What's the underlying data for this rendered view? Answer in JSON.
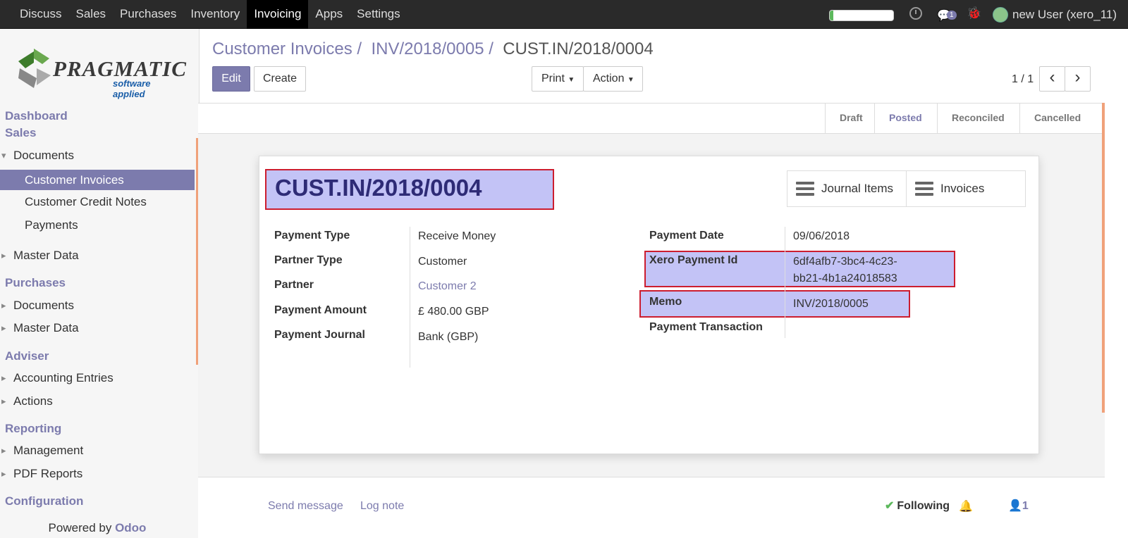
{
  "topbar": {
    "menu": [
      "Discuss",
      "Sales",
      "Purchases",
      "Inventory",
      "Invoicing",
      "Apps",
      "Settings"
    ],
    "active_menu": "Invoicing",
    "chat_count": "1",
    "user": "new User (xero_11)",
    "progress": 0.05
  },
  "sidebar": {
    "logo_word": "PRAGMATIC",
    "logo_tag": "software applied",
    "items": [
      {
        "label": "Dashboard",
        "kind": "head"
      },
      {
        "label": "Sales",
        "kind": "head"
      },
      {
        "label": "Documents",
        "kind": "open"
      },
      {
        "label": "Customer Invoices",
        "kind": "sub-active"
      },
      {
        "label": "Customer Credit Notes",
        "kind": "sub"
      },
      {
        "label": "Payments",
        "kind": "sub"
      },
      {
        "label": "Master Data",
        "kind": "tri"
      },
      {
        "label": "Purchases",
        "kind": "head"
      },
      {
        "label": "Documents",
        "kind": "tri"
      },
      {
        "label": "Master Data",
        "kind": "tri"
      },
      {
        "label": "Adviser",
        "kind": "head"
      },
      {
        "label": "Accounting Entries",
        "kind": "tri"
      },
      {
        "label": "Actions",
        "kind": "tri"
      },
      {
        "label": "Reporting",
        "kind": "head"
      },
      {
        "label": "Management",
        "kind": "tri"
      },
      {
        "label": "PDF Reports",
        "kind": "tri"
      },
      {
        "label": "Configuration",
        "kind": "head"
      }
    ],
    "powered_by": "Powered by",
    "powered_brand": "Odoo"
  },
  "breadcrumb": {
    "items": [
      "Customer Invoices",
      "INV/2018/0005"
    ],
    "current": "CUST.IN/2018/0004",
    "sep": "/"
  },
  "buttons": {
    "edit": "Edit",
    "create": "Create",
    "print": "Print",
    "action": "Action",
    "pager": "1 / 1",
    "prev": "‹",
    "next": "›"
  },
  "statusbar": {
    "stages": [
      "Draft",
      "Posted",
      "Reconciled",
      "Cancelled"
    ],
    "active": "Posted"
  },
  "sheet": {
    "title": "CUST.IN/2018/0004",
    "smart_buttons": [
      "Journal Items",
      "Invoices"
    ],
    "left_fields": [
      {
        "label": "Payment Type",
        "value": "Receive Money"
      },
      {
        "label": "Partner Type",
        "value": "Customer"
      },
      {
        "label": "Partner",
        "value": "Customer 2"
      },
      {
        "label": "Payment Amount",
        "value": "£ 480.00 GBP"
      },
      {
        "label": "Payment Journal",
        "value": "Bank (GBP)"
      }
    ],
    "right_fields": [
      {
        "label": "Payment Date",
        "value": "09/06/2018"
      },
      {
        "label": "Xero Payment Id",
        "value_line1": "6df4afb7-3bc4-4c23-",
        "value_line2": "bb21-4b1a24018583"
      },
      {
        "label": "Memo",
        "value": "INV/2018/0005"
      },
      {
        "label": "Payment Transaction",
        "value": ""
      }
    ]
  },
  "chatter": {
    "send_message": "Send message",
    "log_note": "Log note",
    "following": "Following",
    "followers_count": "1"
  },
  "colors": {
    "brand": "#7c7bad",
    "highlight_fill": "#c3c3f6",
    "highlight_border": "#cc1d2f",
    "title": "#2e2b76"
  }
}
